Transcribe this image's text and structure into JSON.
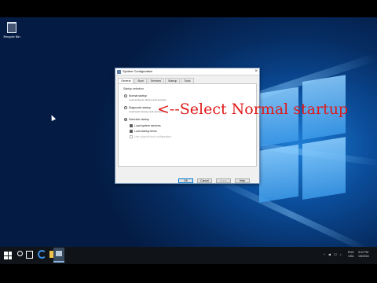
{
  "desktop": {
    "recycle_bin_label": "Recycle Bin"
  },
  "dialog": {
    "title": "System Configuration",
    "close_glyph": "×",
    "tabs": [
      "General",
      "Boot",
      "Services",
      "Startup",
      "Tools"
    ],
    "active_tab": "General",
    "group_label": "Startup selection",
    "options": {
      "normal": {
        "label": "Normal startup",
        "description": "Load all device drivers and services",
        "selected": false
      },
      "diagnostic": {
        "label": "Diagnostic startup",
        "description": "Load basic devices and services only",
        "selected": false
      },
      "selective": {
        "label": "Selective startup",
        "selected": true
      }
    },
    "checkboxes": {
      "system_services": {
        "label": "Load system services",
        "checked": true
      },
      "startup_items": {
        "label": "Load startup items",
        "checked": true
      },
      "original_boot": {
        "label": "Use original boot configuration",
        "checked": false,
        "disabled": true
      }
    },
    "buttons": {
      "ok": "OK",
      "cancel": "Cancel",
      "apply": "Apply",
      "help": "Help"
    }
  },
  "annotation": "<--Select Normal startup",
  "taskbar": {
    "tray_icons": [
      "^",
      "◀",
      "☐",
      "♪"
    ],
    "language": [
      "ENG",
      "USA"
    ],
    "clock_time": "5:02 PM",
    "clock_date": "1/8/2016"
  },
  "colors": {
    "annotation": "#e01919",
    "wallpaper": "#0b4e9c",
    "taskbar": "#101418"
  }
}
